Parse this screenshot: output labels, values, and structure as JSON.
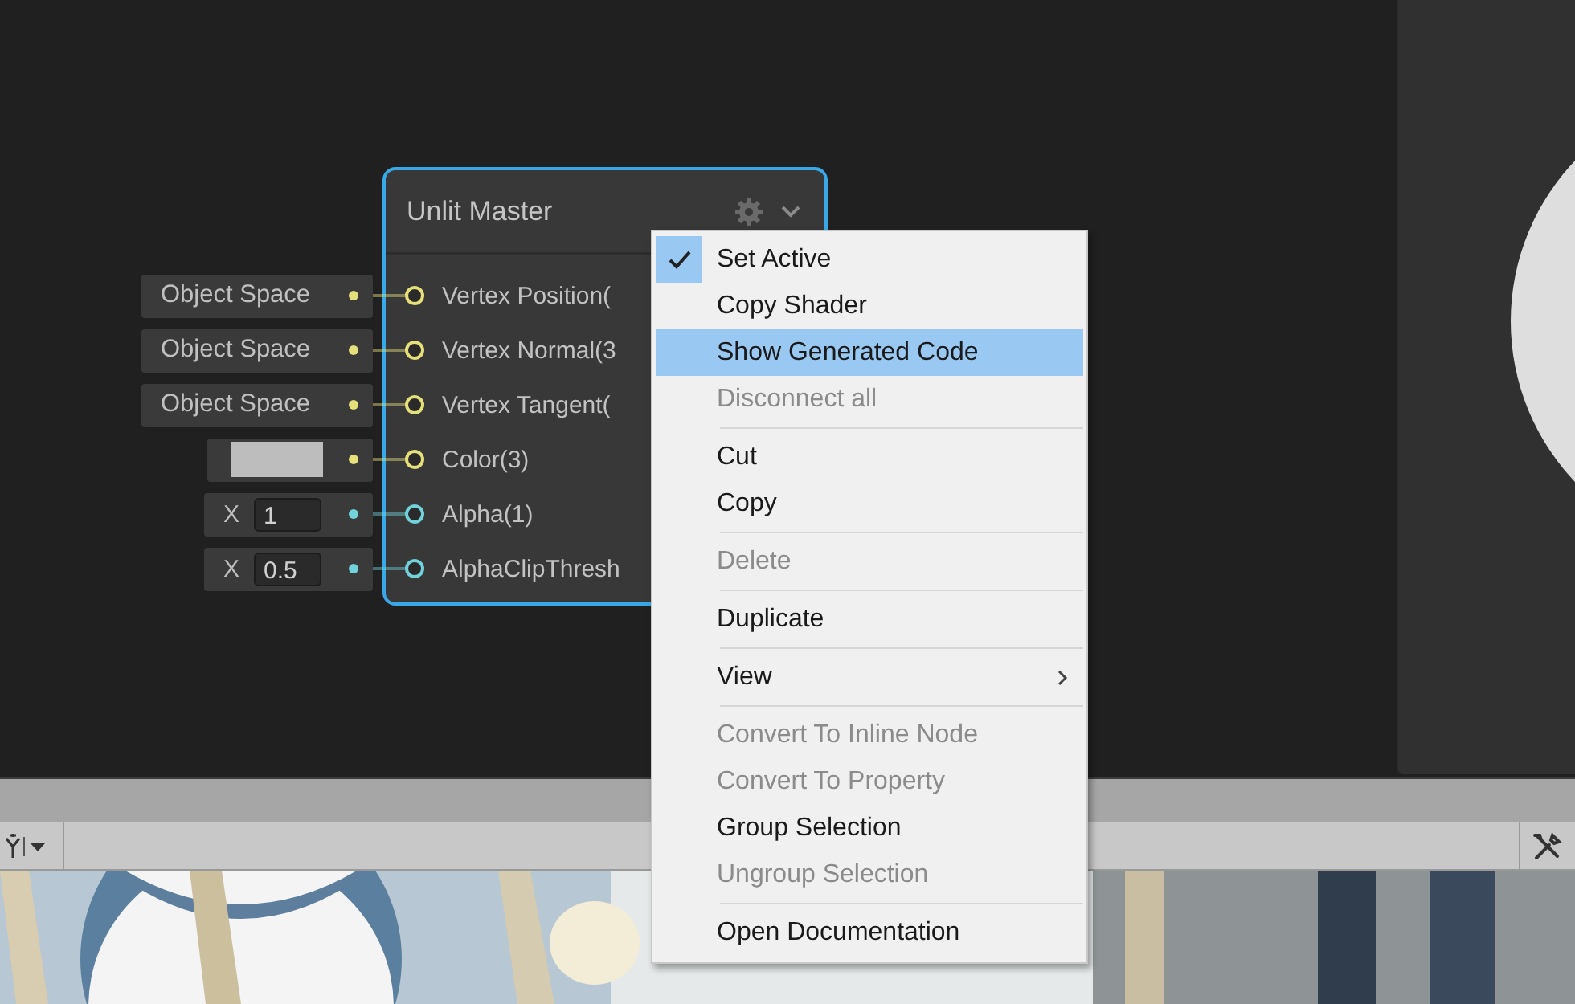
{
  "node": {
    "title": "Unlit Master",
    "ports": [
      {
        "label": "Vertex Position(",
        "color": "#e6e07a",
        "input": {
          "kind": "space",
          "text": "Object Space"
        }
      },
      {
        "label": "Vertex Normal(3",
        "color": "#e6e07a",
        "input": {
          "kind": "space",
          "text": "Object Space"
        }
      },
      {
        "label": "Vertex Tangent(",
        "color": "#e6e07a",
        "input": {
          "kind": "swatch-space",
          "text": "Object Space"
        }
      },
      {
        "label": "Color(3)",
        "color": "#e6e07a",
        "input": {
          "kind": "swatch"
        }
      },
      {
        "label": "Alpha(1)",
        "color": "#72d2dc",
        "input": {
          "kind": "float",
          "axis": "X",
          "value": "1"
        }
      },
      {
        "label": "AlphaClipThresh",
        "color": "#72d2dc",
        "input": {
          "kind": "float",
          "axis": "X",
          "value": "0.5"
        }
      }
    ]
  },
  "context_menu": {
    "items": [
      {
        "kind": "item",
        "label": "Set Active",
        "checked": true,
        "selected": false,
        "disabled": false
      },
      {
        "kind": "item",
        "label": "Copy Shader",
        "checked": false,
        "selected": false,
        "disabled": false
      },
      {
        "kind": "item",
        "label": "Show Generated Code",
        "checked": false,
        "selected": true,
        "disabled": false
      },
      {
        "kind": "item",
        "label": "Disconnect all",
        "checked": false,
        "selected": false,
        "disabled": true
      },
      {
        "kind": "separator"
      },
      {
        "kind": "item",
        "label": "Cut",
        "checked": false,
        "selected": false,
        "disabled": false
      },
      {
        "kind": "item",
        "label": "Copy",
        "checked": false,
        "selected": false,
        "disabled": false
      },
      {
        "kind": "separator"
      },
      {
        "kind": "item",
        "label": "Delete",
        "checked": false,
        "selected": false,
        "disabled": true
      },
      {
        "kind": "separator"
      },
      {
        "kind": "item",
        "label": "Duplicate",
        "checked": false,
        "selected": false,
        "disabled": false
      },
      {
        "kind": "separator"
      },
      {
        "kind": "submenu",
        "label": "View",
        "checked": false,
        "selected": false,
        "disabled": false
      },
      {
        "kind": "separator"
      },
      {
        "kind": "item",
        "label": "Convert To Inline Node",
        "checked": false,
        "selected": false,
        "disabled": true
      },
      {
        "kind": "item",
        "label": "Convert To Property",
        "checked": false,
        "selected": false,
        "disabled": true
      },
      {
        "kind": "item",
        "label": "Group Selection",
        "checked": false,
        "selected": false,
        "disabled": false
      },
      {
        "kind": "item",
        "label": "Ungroup Selection",
        "checked": false,
        "selected": false,
        "disabled": true
      },
      {
        "kind": "separator"
      },
      {
        "kind": "item",
        "label": "Open Documentation",
        "checked": false,
        "selected": false,
        "disabled": false
      }
    ]
  }
}
